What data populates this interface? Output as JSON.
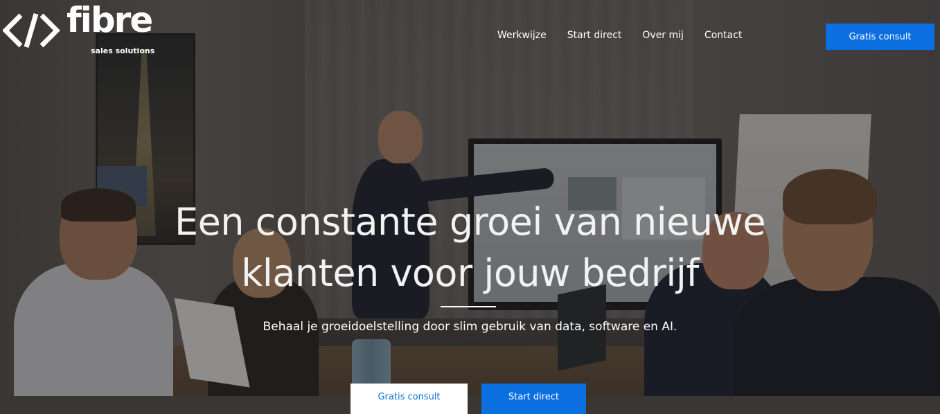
{
  "brand": {
    "name": "fibre",
    "tagline": "sales solutions"
  },
  "nav": {
    "items": [
      "Werkwijze",
      "Start direct",
      "Over mij",
      "Contact"
    ],
    "cta_label": "Gratis consult"
  },
  "hero": {
    "title_line1": "Een constante groei van nieuwe",
    "title_line2": "klanten voor jouw bedrijf",
    "subtitle": "Behaal je groeidoelstelling door slim gebruik van data, software en AI.",
    "primary_button": "Gratis consult",
    "secondary_button": "Start direct"
  },
  "colors": {
    "accent": "#0b6fe0",
    "text_on_dark": "#ffffff",
    "overlay": "rgba(20,18,18,0.42)"
  },
  "icons": {
    "logo_mark": "code-brackets-icon"
  }
}
